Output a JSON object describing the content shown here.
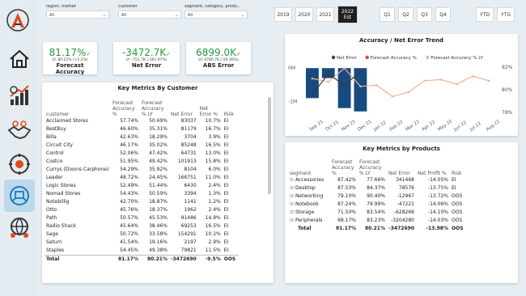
{
  "filters": [
    {
      "label": "region, market",
      "value": "All"
    },
    {
      "label": "customer",
      "value": "All"
    },
    {
      "label": "segment, category, produ...",
      "value": "All"
    }
  ],
  "years": [
    "2019",
    "2020",
    "2021"
  ],
  "selected_year": {
    "year": "2022",
    "sub": "Est"
  },
  "quarters": [
    "Q1",
    "Q2",
    "Q3",
    "Q4"
  ],
  "period_buttons": [
    "YTD",
    "YTG"
  ],
  "kpis": [
    {
      "value": "81.17%",
      "ly": "LY: 80.21% (+1.2%)",
      "name": "Forecast Accuracy",
      "check": "✓"
    },
    {
      "value": "-3472.7K",
      "ly": "LY: -751.7K (-361.97%)",
      "name": "Net Error",
      "check": "✓"
    },
    {
      "value": "6899.0K",
      "ly": "LY: 9780.7K (-29.46%)",
      "name": "ABS Error",
      "check": "✓"
    }
  ],
  "customer_table": {
    "title": "Key Metrics By Customer",
    "columns": [
      "customer",
      "Forecast Accuracy %",
      "Forecast Accuracy % LY",
      "Net Error",
      "Net Error %",
      "Risk"
    ],
    "rows": [
      [
        "Acclaimed Stores",
        "57.74%",
        "50.69%",
        "83037",
        "10.7%",
        "EI"
      ],
      [
        "BestBuy",
        "46.60%",
        "35.31%",
        "81179",
        "16.7%",
        "EI"
      ],
      [
        "Billa",
        "42.63%",
        "18.29%",
        "3704",
        "3.9%",
        "EI"
      ],
      [
        "Circuit City",
        "46.17%",
        "35.02%",
        "85248",
        "16.5%",
        "EI"
      ],
      [
        "Control",
        "52.06%",
        "47.42%",
        "64731",
        "13.0%",
        "EI"
      ],
      [
        "Costco",
        "51.95%",
        "49.42%",
        "101913",
        "15.8%",
        "EI"
      ],
      [
        "Currys (Dixons Carphone)",
        "54.29%",
        "35.92%",
        "8104",
        "6.0%",
        "EI"
      ],
      [
        "Leader",
        "48.72%",
        "24.45%",
        "166751",
        "11.0%",
        "EI"
      ],
      [
        "Logic Stores",
        "52.49%",
        "51.44%",
        "6430",
        "2.4%",
        "EI"
      ],
      [
        "Nomad Stores",
        "54.43%",
        "50.59%",
        "3394",
        "1.3%",
        "EI"
      ],
      [
        "Notebillig",
        "42.70%",
        "18.87%",
        "1141",
        "1.2%",
        "EI"
      ],
      [
        "Otto",
        "45.76%",
        "18.37%",
        "1962",
        "2.4%",
        "EI"
      ],
      [
        "Path",
        "50.57%",
        "45.53%",
        "91486",
        "14.9%",
        "EI"
      ],
      [
        "Radio Shack",
        "45.64%",
        "38.46%",
        "69253",
        "16.5%",
        "EI"
      ],
      [
        "Sage",
        "50.72%",
        "33.58%",
        "154291",
        "10.1%",
        "EI"
      ],
      [
        "Saturn",
        "41.54%",
        "19.16%",
        "2197",
        "2.9%",
        "EI"
      ],
      [
        "Staples",
        "54.45%",
        "49.38%",
        "79821",
        "11.5%",
        "EI"
      ]
    ],
    "total": [
      "Total",
      "81.17%",
      "80.21%",
      "-3472690",
      "-9.5%",
      "OOS"
    ]
  },
  "trend": {
    "title": "Accuracy / Net Error Trend",
    "legend": [
      {
        "name": "Net Error",
        "color": "#174a7e"
      },
      {
        "name": "Forecast Accuracy %",
        "color": "#e0482b"
      },
      {
        "name": "Forecast Accuracy % LY",
        "color": "#f2b28f"
      }
    ],
    "y_left": [
      "0M",
      "-1M"
    ],
    "y_right": [
      "82%",
      "80%",
      "78%"
    ]
  },
  "chart_data": {
    "type": "bar",
    "title": "Accuracy / Net Error Trend",
    "categories": [
      "Sep 21",
      "Oct 21",
      "Nov 21",
      "Dec 21",
      "Jan 22",
      "Feb 22",
      "Mar 22",
      "Apr 22",
      "May 22",
      "Jun 22",
      "Jul 22",
      "Aug 22"
    ],
    "series": [
      {
        "name": "Net Error",
        "values": [
          -0.9,
          -0.3,
          -1.2,
          -1.3,
          0,
          0,
          0,
          0,
          0,
          0,
          0,
          0
        ]
      },
      {
        "name": "Forecast Accuracy %",
        "values": [
          79.6,
          81.4,
          80.4,
          81.6,
          null,
          null,
          null,
          null,
          null,
          null,
          null,
          null
        ]
      },
      {
        "name": "Forecast Accuracy % LY",
        "values": [
          81.0,
          80.7,
          81.9,
          80.3,
          80.4,
          79.4,
          79.8,
          80.8,
          80.9,
          80.5,
          81.2,
          80.8
        ]
      }
    ],
    "y_left_lim": [
      -1.5,
      0.2
    ],
    "y_right_lim": [
      77.5,
      82.5
    ]
  },
  "product_table": {
    "title": "Key Metrics by Products",
    "columns": [
      "segment",
      "Forecast Accuracy %",
      "Forecast Accuracy % LY",
      "Net Error",
      "Net Profit %",
      "Risk"
    ],
    "rows": [
      [
        "Accessories",
        "87.42%",
        "77.66%",
        "341468",
        "-14.05%",
        "EI"
      ],
      [
        "Desktop",
        "87.53%",
        "84.37%",
        "78576",
        "-13.75%",
        "EI"
      ],
      [
        "Networking",
        "79.10%",
        "90.40%",
        "-12967",
        "-13.72%",
        "OOS"
      ],
      [
        "Notebook",
        "87.24%",
        "79.99%",
        "-47221",
        "-14.06%",
        "OOS"
      ],
      [
        "Storage",
        "71.50%",
        "83.54%",
        "-628266",
        "-14.10%",
        "OOS"
      ],
      [
        "Peripherals",
        "68.17%",
        "83.23%",
        "-3204280",
        "-14.03%",
        "OOS"
      ]
    ],
    "total": [
      "Total",
      "81.17%",
      "80.21%",
      "-3472690",
      "-13.98%",
      "OOS"
    ]
  }
}
